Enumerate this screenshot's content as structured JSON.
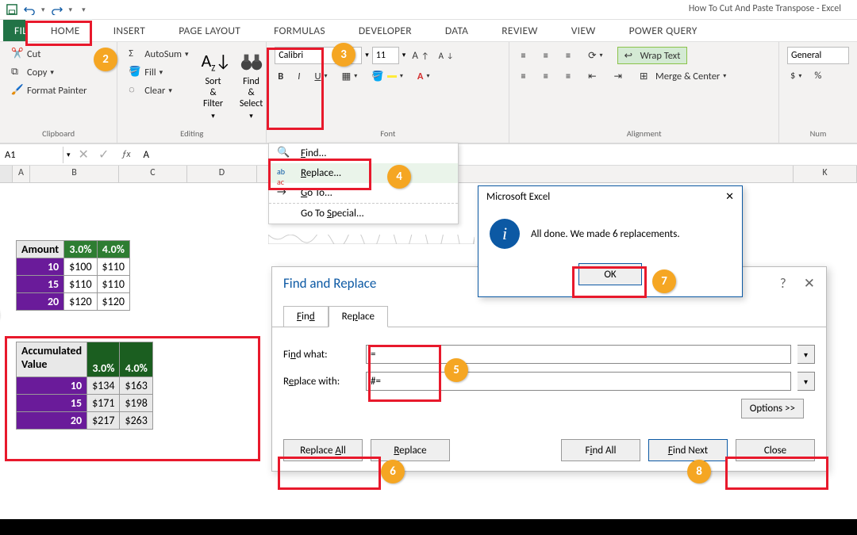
{
  "window": {
    "title": "How To Cut And Paste Transpose - Excel"
  },
  "tabs": {
    "file": "FILE",
    "home": "HOME",
    "insert": "INSERT",
    "page": "PAGE LAYOUT",
    "formulas": "FORMULAS",
    "developer": "DEVELOPER",
    "data": "DATA",
    "review": "REVIEW",
    "view": "VIEW",
    "pq": "POWER QUERY"
  },
  "ribbon": {
    "clipboard": {
      "cut": "Cut",
      "copy": "Copy",
      "paint": "Format Painter",
      "label": "Clipboard"
    },
    "editing": {
      "autosum": "AutoSum",
      "fill": "Fill",
      "clear": "Clear",
      "sort": "Sort & Filter",
      "find": "Find & Select",
      "label": "Editing"
    },
    "font": {
      "name": "Calibri",
      "size": "11",
      "label": "Font"
    },
    "align": {
      "wrap": "Wrap Text",
      "merge": "Merge & Center",
      "label": "Alignment"
    },
    "number": {
      "fmt": "General",
      "label": "Num"
    }
  },
  "namebox": "A1",
  "menu": {
    "find": "Find...",
    "replace": "Replace...",
    "goto": "Go To...",
    "special": "Go To Special..."
  },
  "table1": {
    "h": "Amount",
    "pct1": "3.0%",
    "pct2": "4.0%",
    "rows": [
      [
        "10",
        "$100",
        "$110"
      ],
      [
        "15",
        "$110",
        "$110"
      ],
      [
        "20",
        "$120",
        "$120"
      ]
    ]
  },
  "table2": {
    "h": "Accumulated Value",
    "pct1": "3.0%",
    "pct2": "4.0%",
    "rows": [
      [
        "10",
        "$134",
        "$163"
      ],
      [
        "15",
        "$171",
        "$198"
      ],
      [
        "20",
        "$217",
        "$263"
      ]
    ]
  },
  "msgbox": {
    "title": "Microsoft Excel",
    "text": "All done. We made 6 replacements.",
    "ok": "OK"
  },
  "dlg": {
    "title": "Find and Replace",
    "tfind": "Find",
    "trepl": "Replace",
    "lfind": "Find what:",
    "lrepl": "Replace with:",
    "vfind": "=",
    "vrepl": "#=",
    "opts": "Options >>",
    "rall": "Replace All",
    "repl": "Replace",
    "fall": "Find All",
    "fnext": "Find Next",
    "close": "Close"
  },
  "cols": [
    "A",
    "B",
    "C",
    "D",
    "",
    "",
    "",
    "",
    "",
    "",
    "K"
  ]
}
